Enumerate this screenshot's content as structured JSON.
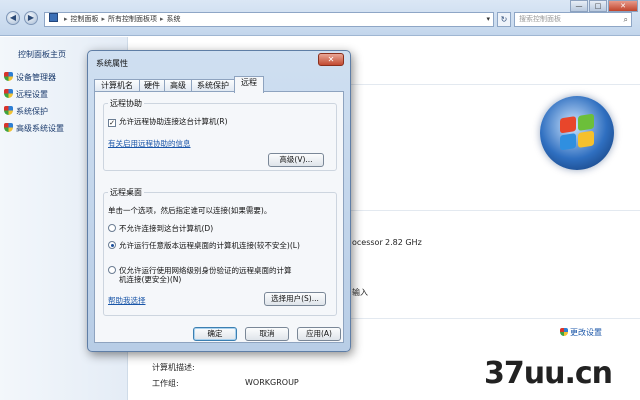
{
  "explorer": {
    "breadcrumb": [
      "控制面板",
      "所有控制面板项",
      "系统"
    ],
    "back_glyph": "◀",
    "forward_glyph": "▶",
    "dropdown_glyph": "▾",
    "refresh_glyph": "↻",
    "search_placeholder": "搜索控制面板",
    "search_glyph": "⌕",
    "window_controls": {
      "minimize": "—",
      "maximize": "□",
      "close": "✕"
    }
  },
  "left_panel": {
    "home": "控制面板主页",
    "items": [
      "设备管理器",
      "远程设置",
      "系统保护",
      "高级系统设置"
    ]
  },
  "background": {
    "processor_label": "ocessor",
    "processor_value": "2.82 GHz",
    "pen_input": "输入",
    "computer_description_label": "计算机描述:",
    "workgroup_label": "工作组:",
    "workgroup_value": "WORKGROUP",
    "change_settings": "更改设置",
    "watermark": "37uu.cn"
  },
  "dialog": {
    "title": "系统属性",
    "close_glyph": "✕",
    "tabs": [
      "计算机名",
      "硬件",
      "高级",
      "系统保护",
      "远程"
    ],
    "active_tab": 4,
    "remote_assistance": {
      "title": "远程协助",
      "allow_checkbox_label": "允许远程协助连接这台计算机(R)",
      "allow_checked": true,
      "check_glyph": "✓",
      "help_link": "有关启用远程协助的信息",
      "advanced_button": "高级(V)..."
    },
    "remote_desktop": {
      "title": "远程桌面",
      "instruction": "单击一个选项，然后指定谁可以连接(如果需要)。",
      "options": [
        "不允许连接到这台计算机(D)",
        "允许运行任意版本远程桌面的计算机连接(较不安全)(L)",
        "仅允许运行使用网络级别身份验证的远程桌面的计算",
        "机连接(更安全)(N)"
      ],
      "selected_option": 1,
      "help_link": "帮助我选择",
      "select_users_button": "选择用户(S)..."
    },
    "buttons": {
      "ok": "确定",
      "cancel": "取消",
      "apply": "应用(A)"
    }
  }
}
